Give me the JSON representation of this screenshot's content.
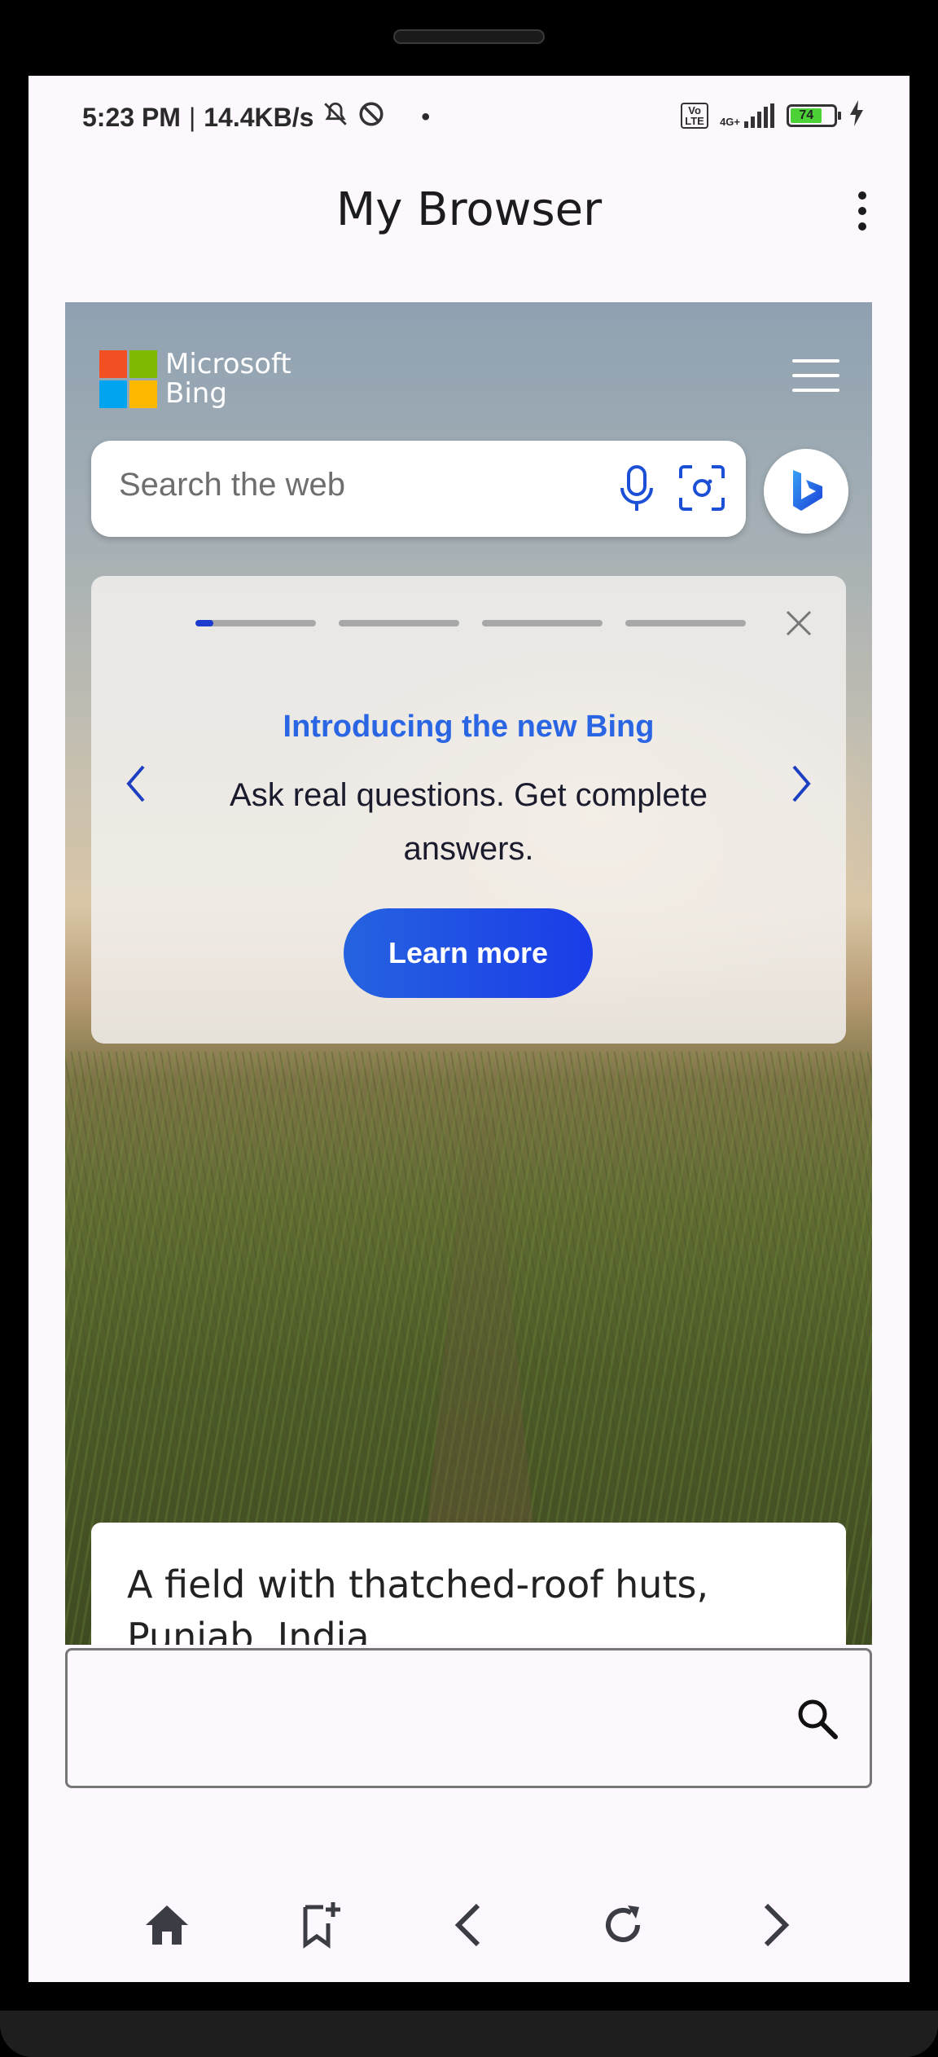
{
  "status_bar": {
    "time": "5:23 PM",
    "net_speed": "14.4KB/s",
    "volte": "Vo LTE",
    "network": "4G+",
    "battery": "74"
  },
  "app_bar": {
    "title": "My Browser",
    "menu_icon": "more-vert-icon"
  },
  "bing": {
    "logo_line1": "Microsoft",
    "logo_line2": "Bing",
    "search_placeholder": "Search the web",
    "promo": {
      "heading": "Introducing the new Bing",
      "body": "Ask real questions. Get complete answers.",
      "button": "Learn more",
      "progress_total": 4,
      "progress_active": 1
    },
    "image_caption": "A field with thatched-roof huts, Punjab, India"
  },
  "colors": {
    "accent": "#2a66e3",
    "button_start": "#2563e0",
    "button_end": "#1b3ce8",
    "ms_red": "#f25022",
    "ms_green": "#7fba00",
    "ms_blue": "#00a4ef",
    "ms_yellow": "#ffb900"
  },
  "bottom_nav": {
    "items": [
      "home-icon",
      "bookmark-add-icon",
      "back-icon",
      "refresh-icon",
      "forward-icon"
    ]
  }
}
